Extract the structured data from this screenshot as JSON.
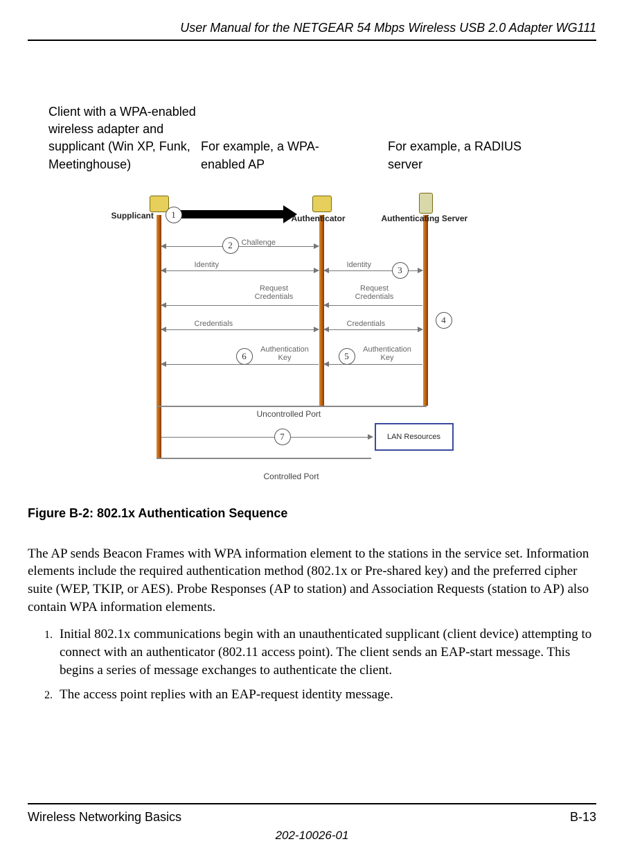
{
  "header": {
    "title": "User Manual for the NETGEAR 54 Mbps Wireless USB 2.0 Adapter WG111"
  },
  "annotations": {
    "col1": "Client with a WPA-enabled wireless adapter and supplicant (Win XP, Funk, Meetinghouse)",
    "col2": "For example, a WPA-enabled AP",
    "col3": "For example, a RADIUS server"
  },
  "diagram": {
    "roles": {
      "supplicant": "Supplicant",
      "authenticator": "Authenticator",
      "auth_server": "Authenticating Server"
    },
    "steps": {
      "1": "1",
      "2": "2",
      "3": "3",
      "4": "4",
      "5": "5",
      "6": "6",
      "7": "7"
    },
    "messages": {
      "challenge": "Challenge",
      "identity_l": "Identity",
      "identity_r": "Identity",
      "req_cred_l": "Request Credentials",
      "req_cred_r": "Request Credentials",
      "credentials_l": "Credentials",
      "credentials_r": "Credentials",
      "auth_key_l": "Authentication Key",
      "auth_key_r": "Authentication Key"
    },
    "ports": {
      "uncontrolled": "Uncontrolled Port",
      "controlled": "Controlled Port"
    },
    "lan": "LAN Resources"
  },
  "figure": {
    "caption": "Figure B-2:  802.1x Authentication Sequence"
  },
  "body": {
    "para1": "The AP sends Beacon Frames with WPA information element to the stations in the service set. Information elements include the required authentication method (802.1x or Pre-shared key) and the preferred cipher suite (WEP, TKIP, or AES). Probe Responses (AP to station) and Association Requests (station to AP) also contain WPA information elements.",
    "list": [
      "Initial 802.1x communications begin with an unauthenticated supplicant (client device) attempting to connect with an authenticator (802.11 access point). The client sends an EAP-start message. This begins a series of message exchanges to authenticate the client.",
      "The access point replies with an EAP-request identity message."
    ]
  },
  "footer": {
    "section": "Wireless Networking Basics",
    "page": "B-13",
    "docnum": "202-10026-01"
  }
}
